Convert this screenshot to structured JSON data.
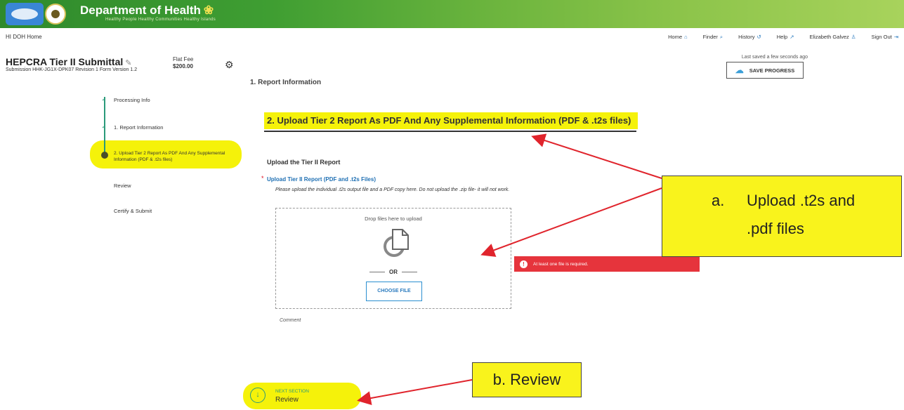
{
  "banner": {
    "title": "Department of Health",
    "symbol": "❀",
    "tagline": "Healthy People Healthy Communities Healthy Islands"
  },
  "topbar": {
    "home_link": "HI DOH Home",
    "nav": [
      {
        "label": "Home",
        "icon": "home-icon",
        "glyph": "⌂"
      },
      {
        "label": "Finder",
        "icon": "search-icon",
        "glyph": "⌕"
      },
      {
        "label": "History",
        "icon": "history-icon",
        "glyph": "↺"
      },
      {
        "label": "Help",
        "icon": "help-icon",
        "glyph": "↗"
      },
      {
        "label": "Elizabeth Galvez",
        "icon": "user-icon",
        "glyph": "♙"
      },
      {
        "label": "Sign Out",
        "icon": "sign-out-icon",
        "glyph": "⇥"
      }
    ]
  },
  "header": {
    "title": "HEPCRA Tier II Submittal",
    "subline": "Submission HHK-JG1X-DPK07   Revision 1   Form Version 1.2",
    "fee_label": "Flat Fee",
    "fee_value": "$200.00",
    "last_saved": "Last saved a few seconds ago",
    "save_label": "SAVE PROGRESS"
  },
  "steps": [
    {
      "label": "Processing Info",
      "state": "complete"
    },
    {
      "label": "1. Report Information",
      "state": "complete"
    },
    {
      "label": "2. Upload Tier 2 Report As PDF And Any Supplemental Information (PDF & .t2s files)",
      "state": "current"
    },
    {
      "label": "Review",
      "state": "upcoming"
    },
    {
      "label": "Certify & Submit",
      "state": "upcoming"
    }
  ],
  "main": {
    "prev_section": "1. Report Information",
    "section_title": "2. Upload Tier 2 Report As PDF And Any Supplemental Information (PDF & .t2s files)",
    "upload_heading": "Upload the Tier II Report",
    "field_label": "Upload Tier II Report (PDF and .t2s Files)",
    "required_mark": "*",
    "help_text": "Please upload the individual .t2s output file and a PDF copy here. Do not upload the .zip file- it will not work.",
    "drop_text": "Drop files here to upload",
    "or_text": "OR",
    "choose_label": "CHOOSE FILE",
    "comment_label": "Comment",
    "error_text": "At least one file is required.",
    "next_small": "NEXT SECTION",
    "next_big": "Review"
  },
  "callouts": {
    "a_num": "a.",
    "a_line1": "Upload .t2s and",
    "a_line2": ".pdf files",
    "b_text": "b. Review"
  },
  "colors": {
    "highlight": "#f5f20a",
    "arrow": "#e0242c",
    "accent": "#2b7bbf",
    "error": "#e6343c"
  }
}
